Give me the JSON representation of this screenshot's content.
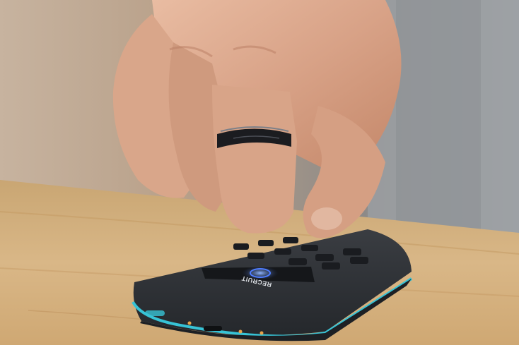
{
  "photo": {
    "subject": "hand-with-smart-ring-tapping-card-reader",
    "colors": {
      "wood": "#d4b07c",
      "skin": "#dca98c",
      "ring": "#1b1c20",
      "device": "#2f3236",
      "accent": "#37c3d6",
      "screen_glow": "#4f7dff"
    }
  },
  "device": {
    "brand_label": "RECRUIT"
  }
}
